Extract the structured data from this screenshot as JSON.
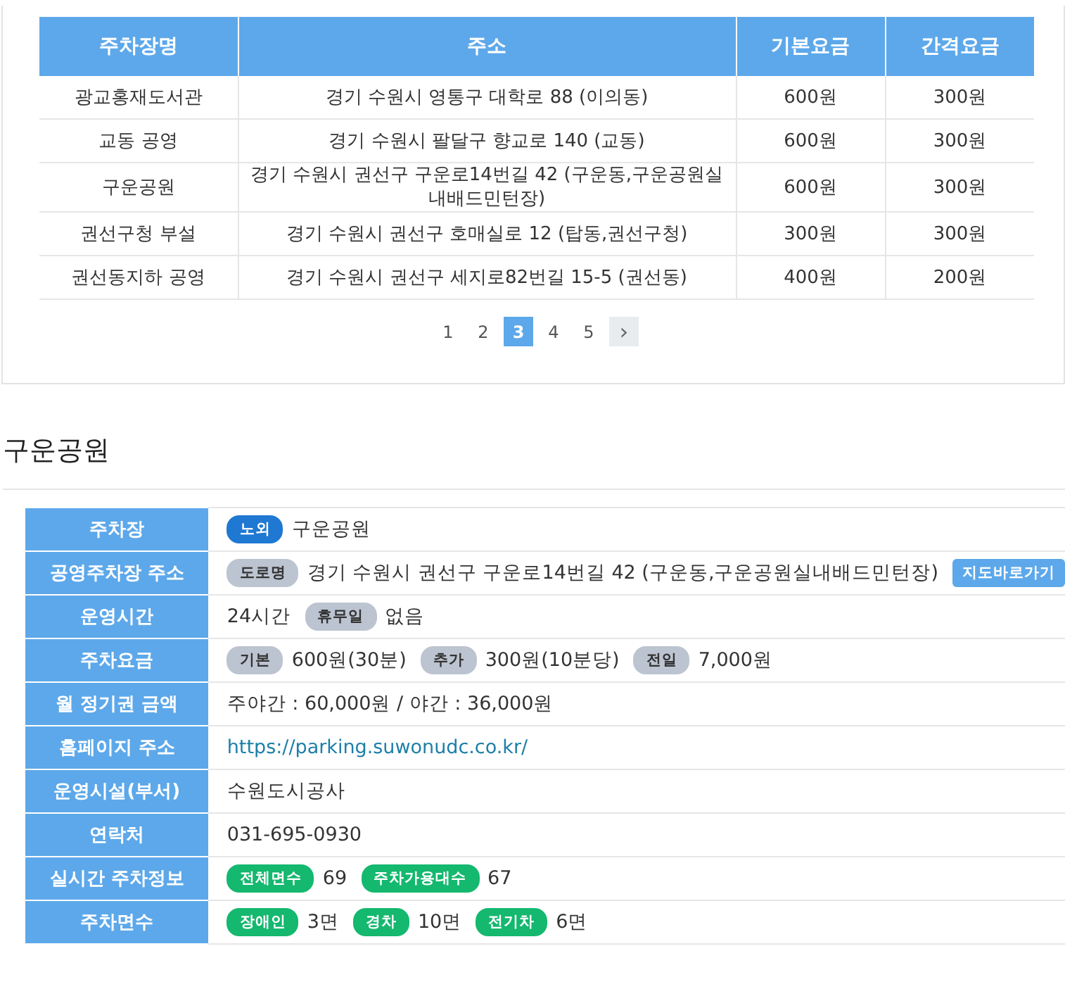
{
  "parking_table": {
    "columns": [
      "주차장명",
      "주소",
      "기본요금",
      "간격요금"
    ],
    "rows": [
      [
        "광교홍재도서관",
        "경기 수원시 영통구 대학로 88 (이의동)",
        "600원",
        "300원"
      ],
      [
        "교동 공영",
        "경기 수원시 팔달구 향교로 140 (교동)",
        "600원",
        "300원"
      ],
      [
        "구운공원",
        "경기 수원시 권선구 구운로14번길 42 (구운동,구운공원실\n내배드민턴장)",
        "600원",
        "300원"
      ],
      [
        "권선구청 부설",
        "경기 수원시 권선구 호매실로 12 (탑동,권선구청)",
        "300원",
        "300원"
      ],
      [
        "권선동지하 공영",
        "경기 수원시 권선구 세지로82번길 15-5 (권선동)",
        "400원",
        "200원"
      ]
    ]
  },
  "pagination": {
    "pages": [
      {
        "label": "1",
        "selected": false
      },
      {
        "label": "2",
        "selected": false
      },
      {
        "label": "3",
        "selected": true
      },
      {
        "label": "4",
        "selected": false
      },
      {
        "label": "5",
        "selected": false
      }
    ],
    "next": "›"
  },
  "detail": {
    "title": "구운공원",
    "rows": [
      {
        "label": "주차장",
        "parts": [
          {
            "kind": "tag",
            "text": "노외",
            "color": "#1f78d1"
          },
          {
            "kind": "text",
            "text": "구운공원"
          }
        ]
      },
      {
        "label": "공영주차장 주소",
        "parts": [
          {
            "kind": "tag",
            "text": "도로명",
            "color": "#bcc4d1"
          },
          {
            "kind": "text",
            "text": "경기 수원시 권선구 구운로14번길 42 (구운동,구운공원실내배드민턴장)"
          },
          {
            "kind": "button",
            "text": "지도바로가기"
          }
        ]
      },
      {
        "label": "운영시간",
        "parts": [
          {
            "kind": "text",
            "text": "24시간"
          },
          {
            "kind": "tag",
            "text": "휴무일",
            "color": "#bcc4d1"
          },
          {
            "kind": "text",
            "text": "없음"
          }
        ]
      },
      {
        "label": "주차요금",
        "parts": [
          {
            "kind": "tag",
            "text": "기본",
            "color": "#bcc4d1"
          },
          {
            "kind": "text",
            "text": "600원(30분)"
          },
          {
            "kind": "tag",
            "text": "추가",
            "color": "#bcc4d1"
          },
          {
            "kind": "text",
            "text": "300원(10분당)"
          },
          {
            "kind": "tag",
            "text": "전일",
            "color": "#bcc4d1"
          },
          {
            "kind": "text",
            "text": "7,000원"
          }
        ]
      },
      {
        "label": "월 정기권 금액",
        "parts": [
          {
            "kind": "text",
            "text": "주야간 : 60,000원 / 야간 : 36,000원"
          }
        ]
      },
      {
        "label": "홈페이지 주소",
        "parts": [
          {
            "kind": "link",
            "text": "https://parking.suwonudc.co.kr/"
          }
        ]
      },
      {
        "label": "운영시설(부서)",
        "parts": [
          {
            "kind": "text",
            "text": "수원도시공사"
          }
        ]
      },
      {
        "label": "연락처",
        "parts": [
          {
            "kind": "text",
            "text": "031-695-0930"
          }
        ]
      },
      {
        "label": "실시간 주차정보",
        "parts": [
          {
            "kind": "tag",
            "text": "전체면수",
            "color": "#14b86e"
          },
          {
            "kind": "text",
            "text": "69"
          },
          {
            "kind": "tag",
            "text": "주차가용대수",
            "color": "#14b86e"
          },
          {
            "kind": "text",
            "text": "67"
          }
        ]
      },
      {
        "label": "주차면수",
        "parts": [
          {
            "kind": "tag",
            "text": "장애인",
            "color": "#14b86e"
          },
          {
            "kind": "text",
            "text": "3면"
          },
          {
            "kind": "tag",
            "text": "경차",
            "color": "#14b86e"
          },
          {
            "kind": "text",
            "text": "10면"
          },
          {
            "kind": "tag",
            "text": "전기차",
            "color": "#14b86e"
          },
          {
            "kind": "text",
            "text": "6면"
          }
        ]
      }
    ]
  }
}
